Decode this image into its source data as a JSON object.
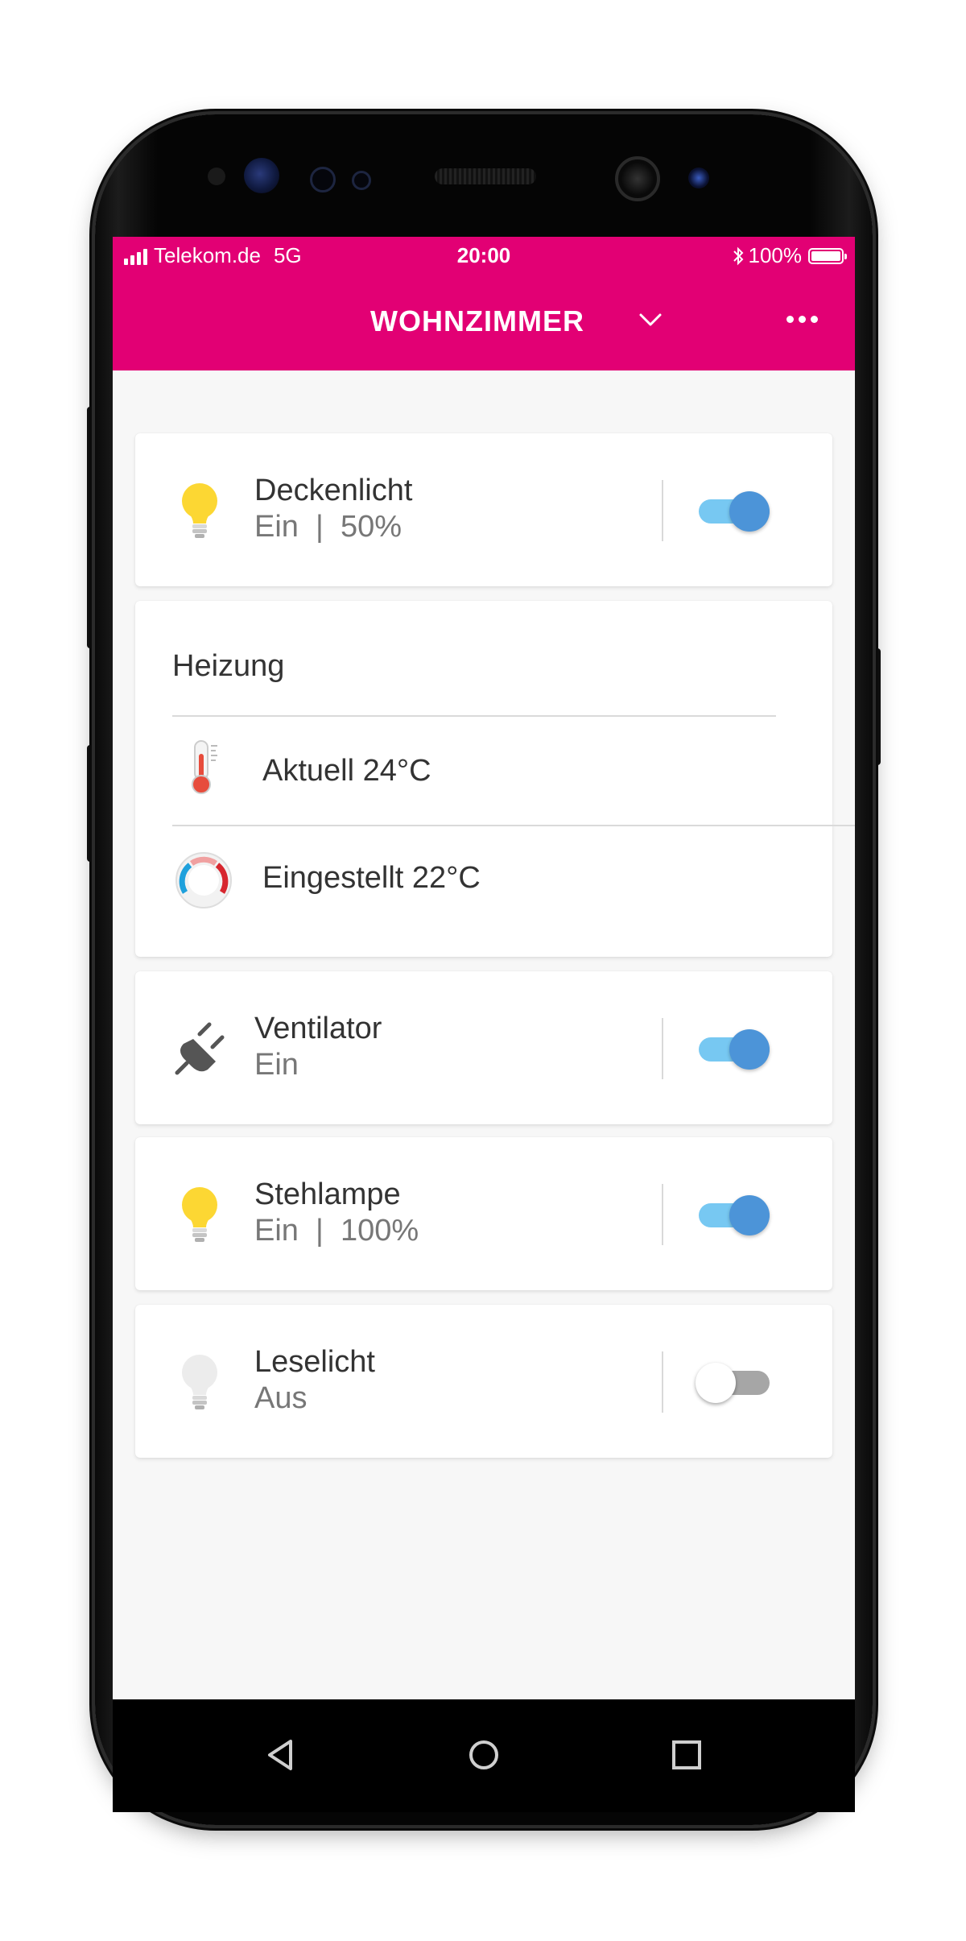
{
  "status_bar": {
    "carrier": "Telekom.de",
    "network": "5G",
    "time": "20:00",
    "bluetooth_icon": "bluetooth-icon",
    "battery": "100%"
  },
  "header": {
    "title": "WOHNZIMMER",
    "dropdown_icon": "chevron-down-icon",
    "menu_icon": "more-horizontal-icon"
  },
  "colors": {
    "brand": "#e20074",
    "toggle_on_track": "#77c8f2",
    "toggle_on_knob": "#4c94d8",
    "toggle_off_track": "#a6a6a6",
    "bulb_on": "#fcd733",
    "bulb_off": "#ececec"
  },
  "devices": [
    {
      "name": "Deckenlicht",
      "state": "Ein  |  50%",
      "icon": "lightbulb-on-icon",
      "on": true
    },
    {
      "name": "Ventilator",
      "state": "Ein",
      "icon": "plug-icon",
      "on": true
    },
    {
      "name": "Stehlampe",
      "state": "Ein  |  100%",
      "icon": "lightbulb-on-icon",
      "on": true
    },
    {
      "name": "Leselicht",
      "state": "Aus",
      "icon": "lightbulb-off-icon",
      "on": false
    }
  ],
  "heating": {
    "title": "Heizung",
    "current": {
      "label": "Aktuell 24°C",
      "icon": "thermometer-icon"
    },
    "target": {
      "label": "Eingestellt 22°C",
      "icon": "thermostat-dial-icon"
    }
  },
  "nav": {
    "back_icon": "back-triangle-icon",
    "home_icon": "home-circle-icon",
    "recents_icon": "recents-square-icon"
  }
}
